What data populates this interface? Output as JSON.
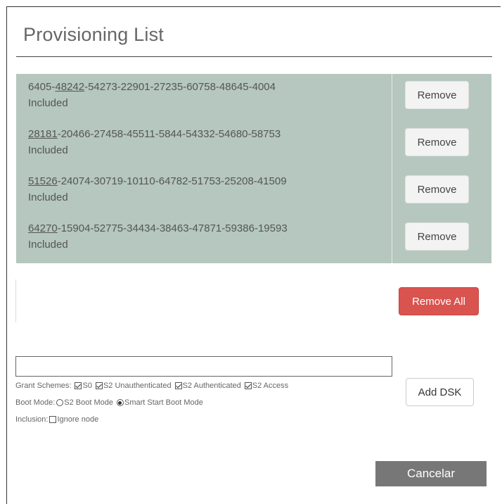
{
  "dialog": {
    "title": "Provisioning List"
  },
  "list": {
    "items": [
      {
        "dsk_prefix": "6405-",
        "dsk_pin": "48242",
        "dsk_suffix": "-54273-22901-27235-60758-48645-4004",
        "status": "Included",
        "remove_label": "Remove"
      },
      {
        "dsk_prefix": "",
        "dsk_pin": "28181",
        "dsk_suffix": "-20466-27458-45511-5844-54332-54680-58753",
        "status": "Included",
        "remove_label": "Remove"
      },
      {
        "dsk_prefix": "",
        "dsk_pin": "51526",
        "dsk_suffix": "-24074-30719-10110-64782-51753-25208-41509",
        "status": "Included",
        "remove_label": "Remove"
      },
      {
        "dsk_prefix": "",
        "dsk_pin": "64270",
        "dsk_suffix": "-15904-52775-34434-38463-47871-59386-19593",
        "status": "Included",
        "remove_label": "Remove"
      }
    ],
    "remove_all_label": "Remove All"
  },
  "add_form": {
    "dsk_value": "",
    "grant_schemes_label": "Grant Schemes:",
    "schemes": [
      {
        "label": "S0",
        "checked": true
      },
      {
        "label": "S2 Unauthenticated",
        "checked": true
      },
      {
        "label": "S2 Authenticated",
        "checked": true
      },
      {
        "label": "S2 Access",
        "checked": true
      }
    ],
    "boot_mode_label": "Boot Mode:",
    "boot_modes": [
      {
        "label": "S2 Boot Mode",
        "checked": false
      },
      {
        "label": "Smart Start Boot Mode",
        "checked": true
      }
    ],
    "inclusion_label": "Inclusion:",
    "ignore_node_label": "Ignore node",
    "ignore_node_checked": false,
    "add_label": "Add DSK"
  },
  "footer": {
    "cancel_label": "Cancelar"
  },
  "colors": {
    "list_bg": "#b5c7bf",
    "danger": "#d9534f",
    "cancel_bg": "#777777"
  }
}
